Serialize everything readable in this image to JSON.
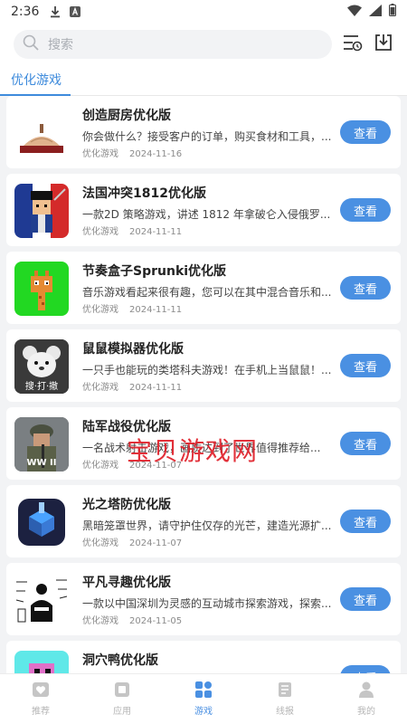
{
  "status": {
    "time": "2:36"
  },
  "search": {
    "placeholder": "搜索"
  },
  "tab": {
    "label": "优化游戏"
  },
  "list_button_label": "查看",
  "games": [
    {
      "title": "创造厨房优化版",
      "desc": "你会做什么？接受客户的订单，购买食材和工具，...",
      "category": "优化游戏",
      "date": "2024-11-16",
      "icon": "kitchen-icon"
    },
    {
      "title": "法国冲突1812优化版",
      "desc": "一款2D 策略游戏，讲述 1812 年拿破仑入侵俄罗...",
      "category": "优化游戏",
      "date": "2024-11-11",
      "icon": "soldier-icon"
    },
    {
      "title": "节奏盒子Sprunki优化版",
      "desc": "音乐游戏看起来很有趣，您可以在其中混合音乐和...",
      "category": "优化游戏",
      "date": "2024-11-11",
      "icon": "giraffe-icon"
    },
    {
      "title": "鼠鼠模拟器优化版",
      "desc": "一只手也能玩的类塔科夫游戏！在手机上当鼠鼠！...",
      "category": "优化游戏",
      "date": "2024-11-11",
      "icon": "mouse-icon",
      "badge": "搜·打·撤"
    },
    {
      "title": "陆军战役优化版",
      "desc": "一名战术射击游戏，画质达到了世界值得推荐给...",
      "category": "优化游戏",
      "date": "2024-11-07",
      "icon": "ww2-icon",
      "badge": "WW II"
    },
    {
      "title": "光之塔防优化版",
      "desc": "黑暗笼罩世界，请守护住仅存的光芒，建造光源扩...",
      "category": "优化游戏",
      "date": "2024-11-07",
      "icon": "tower-icon"
    },
    {
      "title": "平凡寻趣优化版",
      "desc": "一款以中国深圳为灵感的互动城市探索游戏，探索...",
      "category": "优化游戏",
      "date": "2024-11-05",
      "icon": "city-icon"
    },
    {
      "title": "洞穴鸭优化版",
      "desc": "",
      "category": "",
      "date": "",
      "icon": "duck-icon"
    }
  ],
  "watermark": "宝贝游戏网",
  "nav": [
    {
      "label": "推荐",
      "icon": "heart-icon",
      "active": false
    },
    {
      "label": "应用",
      "icon": "app-icon",
      "active": false
    },
    {
      "label": "游戏",
      "icon": "grid-icon",
      "active": true
    },
    {
      "label": "线报",
      "icon": "news-icon",
      "active": false
    },
    {
      "label": "我的",
      "icon": "user-icon",
      "active": false
    }
  ],
  "colors": {
    "accent": "#4a90e2",
    "tab": "#3e8bdc",
    "watermark": "#e0202a"
  }
}
